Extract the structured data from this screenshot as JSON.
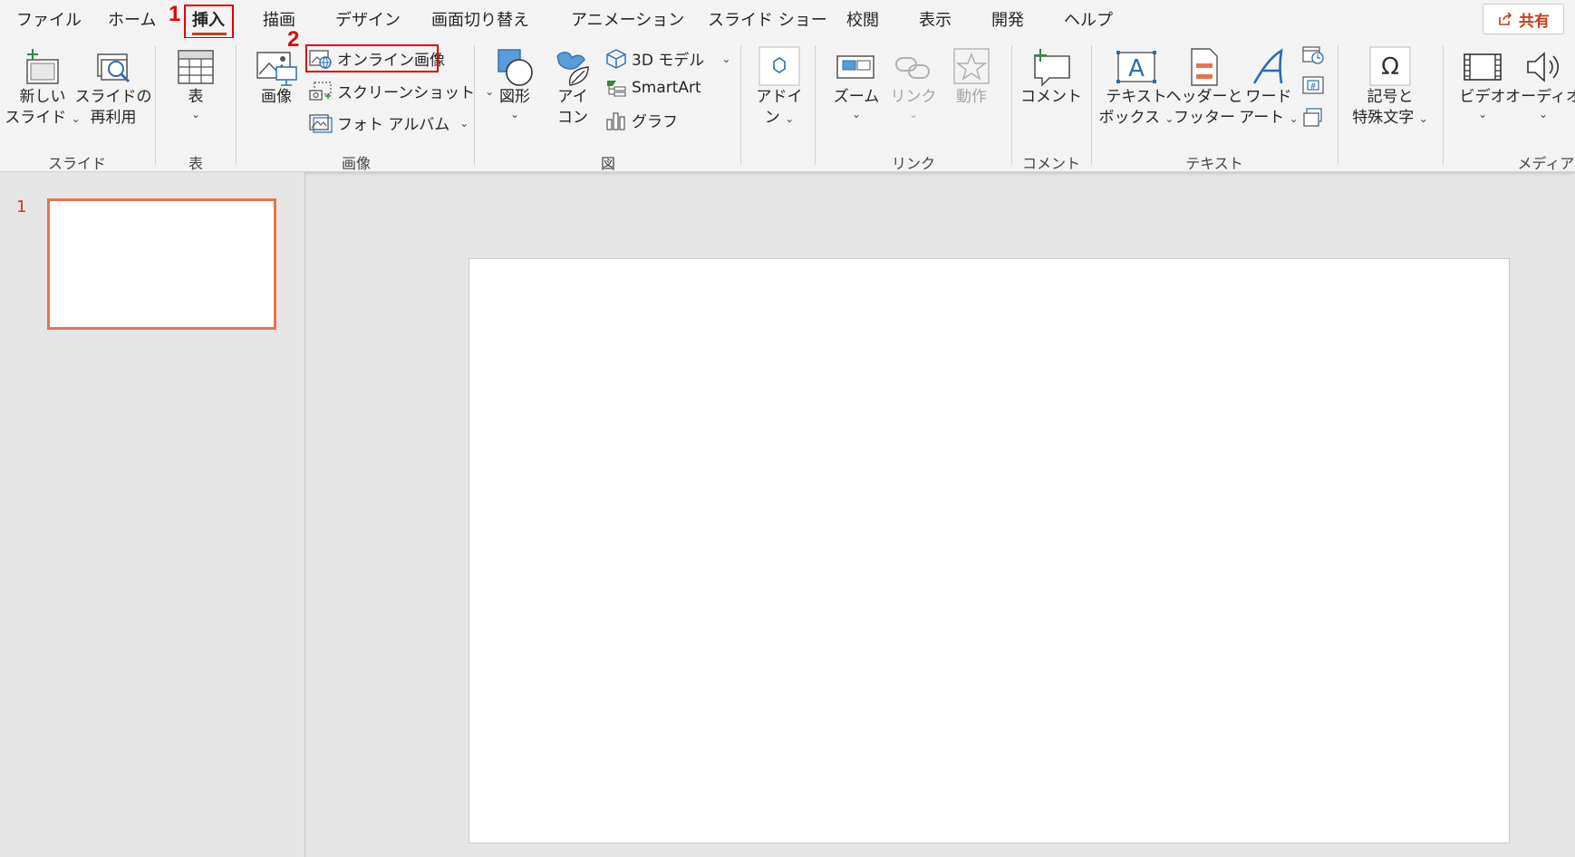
{
  "tabs": [
    {
      "key": "file",
      "label": "ファイル"
    },
    {
      "key": "home",
      "label": "ホーム"
    },
    {
      "key": "insert",
      "label": "挿入",
      "active": true
    },
    {
      "key": "draw",
      "label": "描画"
    },
    {
      "key": "design",
      "label": "デザイン"
    },
    {
      "key": "transitions",
      "label": "画面切り替え"
    },
    {
      "key": "animations",
      "label": "アニメーション"
    },
    {
      "key": "slideshow",
      "label": "スライド ショー"
    },
    {
      "key": "review",
      "label": "校閲"
    },
    {
      "key": "view",
      "label": "表示"
    },
    {
      "key": "developer",
      "label": "開発"
    },
    {
      "key": "help",
      "label": "ヘルプ"
    }
  ],
  "share": {
    "label": "共有",
    "icon": "share-icon"
  },
  "callouts": {
    "one": "1",
    "two": "2"
  },
  "groups": {
    "slides": {
      "label": "スライド",
      "new_slide": {
        "line1": "新しい",
        "line2": "スライド"
      },
      "reuse": {
        "line1": "スライドの",
        "line2": "再利用"
      }
    },
    "tables": {
      "label": "表",
      "table": "表"
    },
    "images": {
      "label": "画像",
      "picture": "画像",
      "online": "オンライン画像",
      "screenshot": "スクリーンショット",
      "album": "フォト アルバム"
    },
    "illustrations": {
      "label": "図",
      "shapes": "図形",
      "icons": {
        "line1": "アイ",
        "line2": "コン"
      },
      "model3d": "3D モデル",
      "smartart": "SmartArt",
      "chart": "グラフ"
    },
    "addins": {
      "line1": "アドイ",
      "line2": "ン"
    },
    "links": {
      "label": "リンク",
      "zoom": "ズーム",
      "link": "リンク",
      "action": "動作"
    },
    "comments": {
      "label": "コメント",
      "comment": "コメント"
    },
    "text": {
      "label": "テキスト",
      "textbox": {
        "line1": "テキスト",
        "line2": "ボックス"
      },
      "header": {
        "line1": "ヘッダーと",
        "line2": "フッター"
      },
      "wordart": {
        "line1": "ワード",
        "line2": "アート"
      }
    },
    "symbols": {
      "line1": "記号と",
      "line2": "特殊文字"
    },
    "media": {
      "label": "メディア",
      "video": "ビデオ",
      "audio": "オーディオ"
    }
  },
  "slides_panel": {
    "slide_number": "1"
  },
  "colors": {
    "accent": "#c43e1c",
    "highlight": "#e00000",
    "ribbon_bg": "#f3f3f3",
    "workspace_bg": "#e6e6e6"
  }
}
